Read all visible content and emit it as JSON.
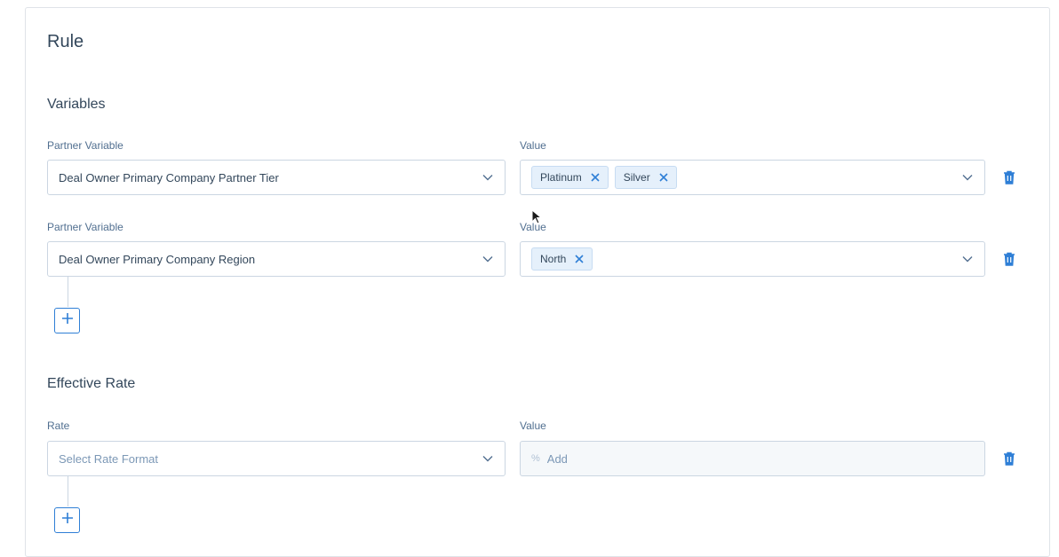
{
  "rule": {
    "title": "Rule"
  },
  "variables": {
    "heading": "Variables",
    "rows": [
      {
        "partner_label": "Partner Variable",
        "partner_value": "Deal Owner Primary Company Partner Tier",
        "value_label": "Value",
        "chips": [
          "Platinum",
          "Silver"
        ]
      },
      {
        "partner_label": "Partner Variable",
        "partner_value": "Deal Owner Primary Company Region",
        "value_label": "Value",
        "chips": [
          "North"
        ]
      }
    ]
  },
  "effective_rate": {
    "heading": "Effective Rate",
    "rate_label": "Rate",
    "rate_placeholder": "Select Rate Format",
    "value_label": "Value",
    "value_prefix": "%",
    "value_placeholder": "Add"
  },
  "icons": {
    "chevron": "chevron-down-icon",
    "remove": "close-icon",
    "delete": "trash-icon",
    "add": "plus-icon"
  },
  "colors": {
    "accent": "#2f7fd6",
    "chip_bg": "#e5f0fb",
    "border": "#cbd6e2"
  }
}
